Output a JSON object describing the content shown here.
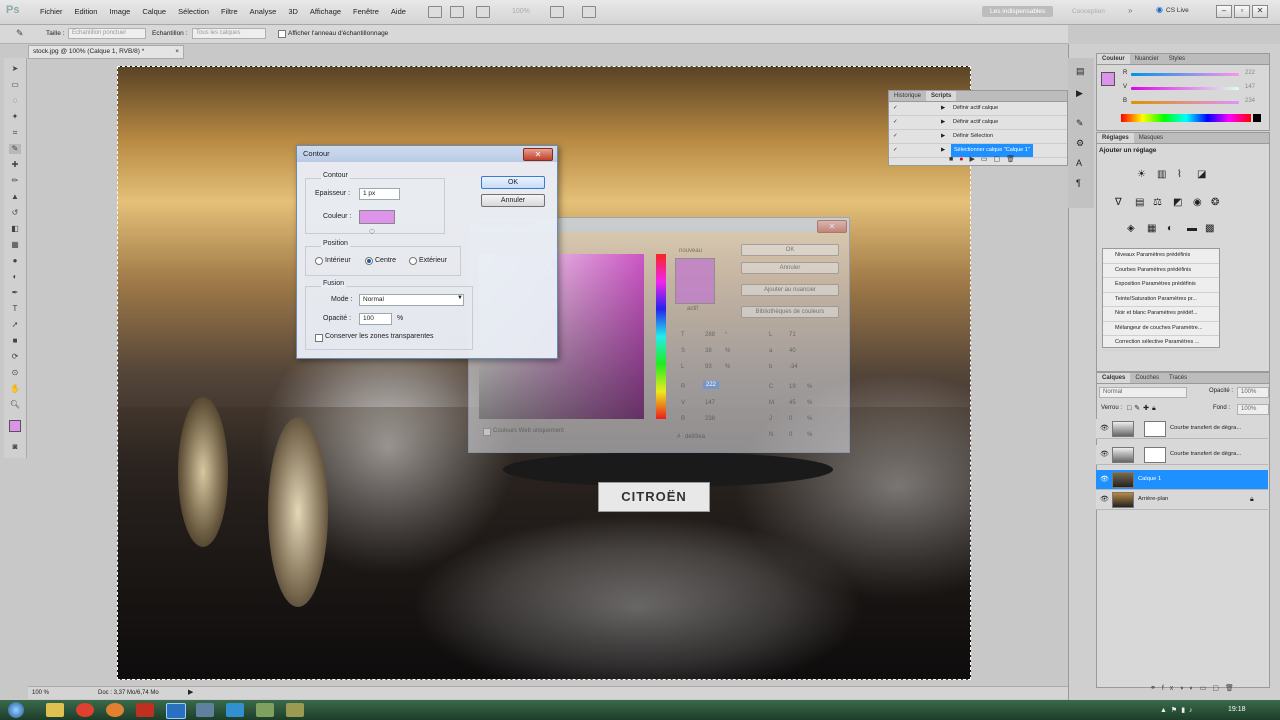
{
  "app": {
    "logo": "Ps",
    "menus": [
      "Fichier",
      "Edition",
      "Image",
      "Calque",
      "Sélection",
      "Filtre",
      "Analyse",
      "3D",
      "Affichage",
      "Fenêtre",
      "Aide"
    ],
    "zoom_menu": "100%",
    "workspace_essentials": "Les indispensables",
    "workspace_other": "Conception",
    "cs_live": "CS Live",
    "win_min": "–",
    "win_max": "▫",
    "win_close": "✕"
  },
  "options": {
    "size_label": "Taille :",
    "size_value": "Echantillon ponctuel",
    "sample_label": "Echantillon :",
    "sample_value": "Tous les calques",
    "ring_label": "Afficher l'anneau d'échantillonnage"
  },
  "document": {
    "tab_title": "stock.jpg @ 100% (Calque 1, RVB/8) *",
    "tab_close": "×",
    "plate_text": "CITROËN"
  },
  "status": {
    "zoom": "100 %",
    "doc_info": "Doc : 3,37 Mo/6,74 Mo"
  },
  "actions_panel": {
    "tabs": [
      "Historique",
      "Scripts"
    ],
    "rows": [
      "Définir actif calque",
      "Définir actif calque",
      "Définir Sélection",
      "Sélectionner calque \"Calque 1\""
    ]
  },
  "color_panel": {
    "tabs": [
      "Couleur",
      "Nuancier",
      "Styles"
    ],
    "r_label": "R",
    "g_label": "V",
    "b_label": "B",
    "r_value": "222",
    "g_value": "147",
    "b_value": "234",
    "foreground_color": "#de93ea"
  },
  "adjust_panel": {
    "tabs": [
      "Réglages",
      "Masques"
    ],
    "heading": "Ajouter un réglage",
    "presets": [
      "Niveaux Paramètres prédéfinis",
      "Courbes Paramètres prédéfinis",
      "Exposition Paramètres prédéfinis",
      "Teinte/Saturation Paramètres pr...",
      "Noir et blanc Paramètres prédéf...",
      "Mélangeur de couches Paramètre...",
      "Correction sélective Paramètres ..."
    ]
  },
  "layers_panel": {
    "tabs": [
      "Calques",
      "Couches",
      "Tracés"
    ],
    "blend_mode": "Normal",
    "opacity_label": "Opacité :",
    "opacity_value": "100%",
    "lock_label": "Verrou :",
    "fill_label": "Fond :",
    "fill_value": "100%",
    "layers": [
      {
        "name": "Courbe transfert de dégra...",
        "selected": false
      },
      {
        "name": "Courbe transfert de dégra...",
        "selected": false
      },
      {
        "name": "Calque 1",
        "selected": true
      },
      {
        "name": "Arrière-plan",
        "selected": false
      }
    ]
  },
  "stroke_dialog": {
    "title": "Contour",
    "group_stroke": "Contour",
    "width_label": "Epaisseur :",
    "width_value": "1 px",
    "color_label": "Couleur :",
    "color_value": "#de93ea",
    "group_position": "Position",
    "pos_inside": "Intérieur",
    "pos_center": "Centre",
    "pos_outside": "Extérieur",
    "group_blend": "Fusion",
    "mode_label": "Mode :",
    "mode_value": "Normal",
    "opacity_label": "Opacité :",
    "opacity_value": "100",
    "opacity_unit": "%",
    "preserve_label": "Conserver les zones transparentes",
    "ok": "OK",
    "cancel": "Annuler"
  },
  "color_picker": {
    "title": "Couleur du contour :",
    "new_label": "nouveau",
    "current_label": "actif",
    "ok": "OK",
    "cancel": "Annuler",
    "add_swatch": "Ajouter au nuancier",
    "libraries": "Bibliothèques de couleurs",
    "h_label": "T",
    "h_value": "288",
    "h_unit": "°",
    "s_label": "S",
    "s_value": "38",
    "s_unit": "%",
    "br_label": "L",
    "br_value": "93",
    "br_unit": "%",
    "r_label": "R",
    "r_value": "222",
    "g_label": "V",
    "g_value": "147",
    "b_label": "B",
    "b_value": "238",
    "l_label": "L",
    "l_value": "71",
    "a_label": "a",
    "a_value": "40",
    "bb_label": "b",
    "bb_value": "-34",
    "c_label": "C",
    "c_value": "19",
    "c_unit": "%",
    "m_label": "M",
    "m_value": "45",
    "m_unit": "%",
    "y_label": "J",
    "y_value": "0",
    "y_unit": "%",
    "k_label": "N",
    "k_value": "0",
    "k_unit": "%",
    "hex_value": "de93ea",
    "web_only": "Couleurs Web uniquement"
  },
  "taskbar": {
    "clock": "19:18"
  }
}
